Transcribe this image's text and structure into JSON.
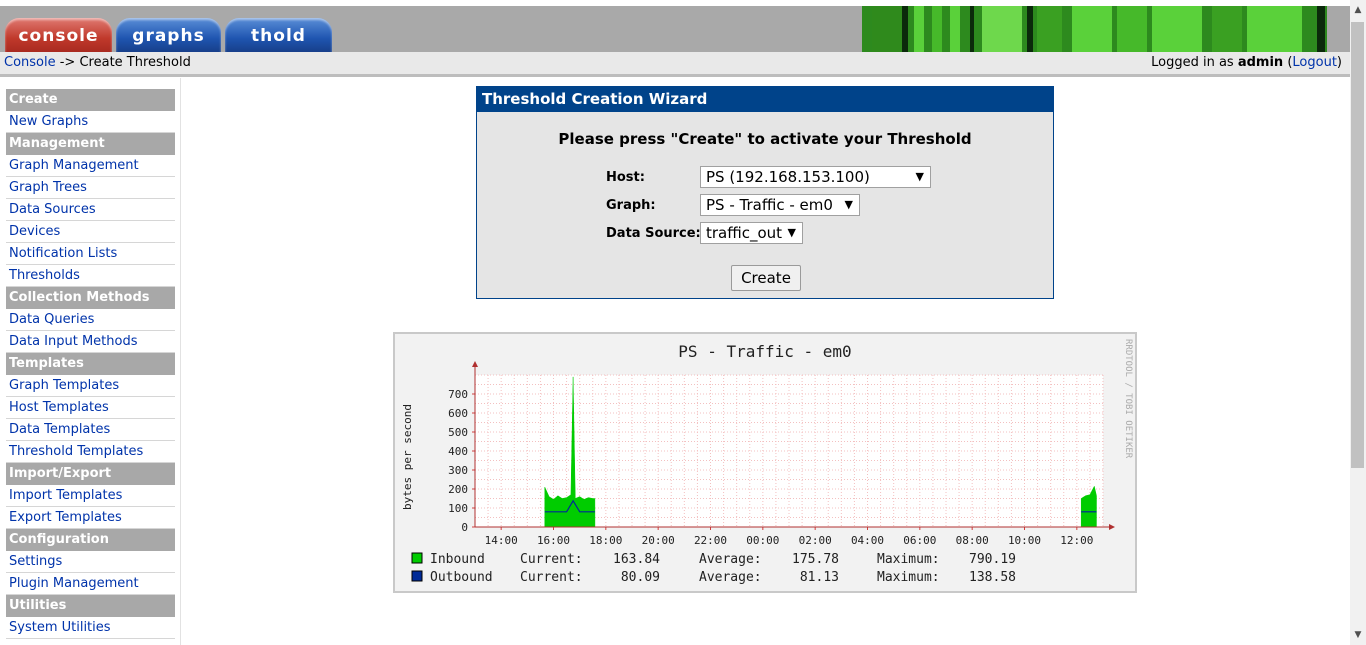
{
  "tabs": [
    {
      "label": "console"
    },
    {
      "label": "graphs"
    },
    {
      "label": "thold"
    }
  ],
  "breadcrumb": {
    "link": "Console",
    "separator": " -> ",
    "current": "Create Threshold"
  },
  "login": {
    "prefix": "Logged in as ",
    "user": "admin",
    "open": " (",
    "logout": "Logout",
    "close": ")"
  },
  "sidebar": {
    "sections": [
      {
        "header": "Create",
        "items": [
          "New Graphs"
        ]
      },
      {
        "header": "Management",
        "items": [
          "Graph Management",
          "Graph Trees",
          "Data Sources",
          "Devices",
          "Notification Lists",
          "Thresholds"
        ]
      },
      {
        "header": "Collection Methods",
        "items": [
          "Data Queries",
          "Data Input Methods"
        ]
      },
      {
        "header": "Templates",
        "items": [
          "Graph Templates",
          "Host Templates",
          "Data Templates",
          "Threshold Templates"
        ]
      },
      {
        "header": "Import/Export",
        "items": [
          "Import Templates",
          "Export Templates"
        ]
      },
      {
        "header": "Configuration",
        "items": [
          "Settings",
          "Plugin Management"
        ]
      },
      {
        "header": "Utilities",
        "items": [
          "System Utilities"
        ]
      }
    ]
  },
  "wizard": {
    "title": "Threshold Creation Wizard",
    "prompt": "Please press \"Create\" to activate your Threshold",
    "host_label": "Host:",
    "host_value": "PS (192.168.153.100)",
    "graph_label": "Graph:",
    "graph_value": "PS - Traffic - em0",
    "ds_label": "Data Source:",
    "ds_value": "traffic_out",
    "create_label": "Create"
  },
  "graph": {
    "title": "PS - Traffic - em0",
    "watermark": "RRDTOOL / TOBI OETIKER",
    "ylabel": "bytes per second",
    "legend": [
      {
        "name": "Inbound",
        "color": "#00cc00",
        "current_label": "Current:",
        "current": "163.84",
        "average_label": "Average:",
        "average": "175.78",
        "maximum_label": "Maximum:",
        "maximum": "790.19"
      },
      {
        "name": "Outbound",
        "color": "#002a97",
        "current_label": "Current:",
        "current": "80.09",
        "average_label": "Average:",
        "average": "81.13",
        "maximum_label": "Maximum:",
        "maximum": "138.58"
      }
    ]
  },
  "chart_data": {
    "type": "area",
    "title": "PS - Traffic - em0",
    "ylabel": "bytes per second",
    "xlabel": "",
    "ylim": [
      0,
      800
    ],
    "y_ticks": [
      "0",
      "100",
      "200",
      "300",
      "400",
      "500",
      "600",
      "700"
    ],
    "x_ticks": [
      "14:00",
      "16:00",
      "18:00",
      "20:00",
      "22:00",
      "00:00",
      "02:00",
      "04:00",
      "06:00",
      "08:00",
      "10:00",
      "12:00"
    ],
    "grid": true,
    "series": [
      {
        "name": "Inbound",
        "color": "#00cc00",
        "x": [
          "15:40",
          "15:50",
          "16:00",
          "16:10",
          "16:20",
          "16:30",
          "16:40",
          "16:45",
          "16:50",
          "17:00",
          "17:10",
          "17:20",
          "17:30",
          "17:35",
          "12:10",
          "12:20",
          "12:30",
          "12:40",
          "12:45"
        ],
        "values": [
          210,
          160,
          145,
          165,
          150,
          155,
          170,
          790,
          150,
          160,
          145,
          155,
          150,
          150,
          150,
          165,
          170,
          215,
          164
        ]
      },
      {
        "name": "Outbound",
        "color": "#002a97",
        "x": [
          "15:40",
          "16:00",
          "16:30",
          "16:45",
          "17:00",
          "17:35",
          "12:10",
          "12:45"
        ],
        "values": [
          80,
          80,
          80,
          138,
          80,
          80,
          80,
          80
        ]
      }
    ]
  },
  "colors": {
    "accent": "#00438a",
    "link": "#0033aa",
    "sidebar_header": "#a8a8a8"
  },
  "icons": [
    "dropdown-arrow-icon",
    "scroll-up-icon",
    "scroll-down-icon"
  ]
}
